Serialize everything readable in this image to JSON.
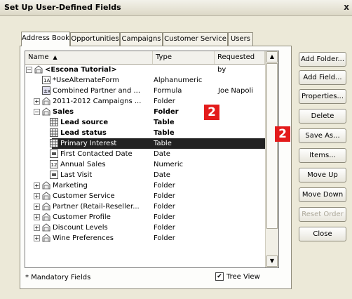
{
  "window": {
    "title": "Set Up User-Defined Fields",
    "close_glyph": "x"
  },
  "tabs": [
    {
      "label": "Address Book",
      "active": true
    },
    {
      "label": "Opportunities",
      "active": false
    },
    {
      "label": "Campaigns",
      "active": false
    },
    {
      "label": "Customer Service",
      "active": false
    },
    {
      "label": "Users",
      "active": false
    }
  ],
  "list": {
    "columns": {
      "name": "Name",
      "sort_glyph": "▲",
      "type": "Type",
      "requested_by": "Requested by"
    },
    "rows": [
      {
        "name": "<Escona Tutorial>",
        "type": "",
        "requested_by": "",
        "icon": "folder-icon",
        "bold": true,
        "expander": "−"
      },
      {
        "name": "*UseAlternateForm",
        "type": "Alphanumeric",
        "requested_by": "",
        "icon": "alphanumeric-field-icon"
      },
      {
        "name": "Combined Partner and ...",
        "type": "Formula",
        "requested_by": "Joe Napoli",
        "icon": "formula-field-icon"
      },
      {
        "name": "2011-2012 Campaigns ...",
        "type": "Folder",
        "requested_by": "",
        "icon": "folder-icon",
        "expander": "+"
      },
      {
        "name": "Sales",
        "type": "Folder",
        "requested_by": "",
        "icon": "folder-icon",
        "bold": true,
        "expander": "−"
      },
      {
        "name": "Lead source",
        "type": "Table",
        "requested_by": "",
        "icon": "table-field-icon",
        "bold": true
      },
      {
        "name": "Lead status",
        "type": "Table",
        "requested_by": "",
        "icon": "table-field-icon",
        "bold": true
      },
      {
        "name": "Primary Interest",
        "type": "Table",
        "requested_by": "",
        "icon": "table-field-icon",
        "selected": true
      },
      {
        "name": "First Contacted Date",
        "type": "Date",
        "requested_by": "",
        "icon": "date-field-icon"
      },
      {
        "name": "Annual Sales",
        "type": "Numeric",
        "requested_by": "",
        "icon": "numeric-field-icon"
      },
      {
        "name": "Last Visit",
        "type": "Date",
        "requested_by": "",
        "icon": "date-field-icon"
      },
      {
        "name": "Marketing",
        "type": "Folder",
        "requested_by": "",
        "icon": "folder-icon",
        "expander": "+"
      },
      {
        "name": "Customer Service",
        "type": "Folder",
        "requested_by": "",
        "icon": "folder-icon",
        "expander": "+"
      },
      {
        "name": "Partner (Retail-Reseller...",
        "type": "Folder",
        "requested_by": "",
        "icon": "folder-icon",
        "expander": "+"
      },
      {
        "name": "Customer Profile",
        "type": "Folder",
        "requested_by": "",
        "icon": "folder-icon",
        "expander": "+"
      },
      {
        "name": "Discount Levels",
        "type": "Folder",
        "requested_by": "",
        "icon": "folder-icon",
        "expander": "+"
      },
      {
        "name": "Wine Preferences",
        "type": "Folder",
        "requested_by": "",
        "icon": "folder-icon",
        "expander": "+"
      }
    ]
  },
  "buttons": {
    "add_folder": "Add Folder...",
    "add_field": "Add Field...",
    "properties": "Properties...",
    "delete": "Delete",
    "save_as": "Save As...",
    "items": "Items...",
    "move_up": "Move Up",
    "move_down": "Move Down",
    "reset_order": "Reset Order",
    "close": "Close"
  },
  "footer": {
    "mandatory_note": "* Mandatory Fields",
    "tree_view_label": "Tree View",
    "tree_view_checked": true,
    "check_glyph": "✔"
  },
  "callouts": {
    "list_badge": "2",
    "button_badge": "2"
  },
  "colors": {
    "selection": "#222222",
    "badge": "#e31b1b",
    "dialog_bg": "#ece9d8"
  }
}
